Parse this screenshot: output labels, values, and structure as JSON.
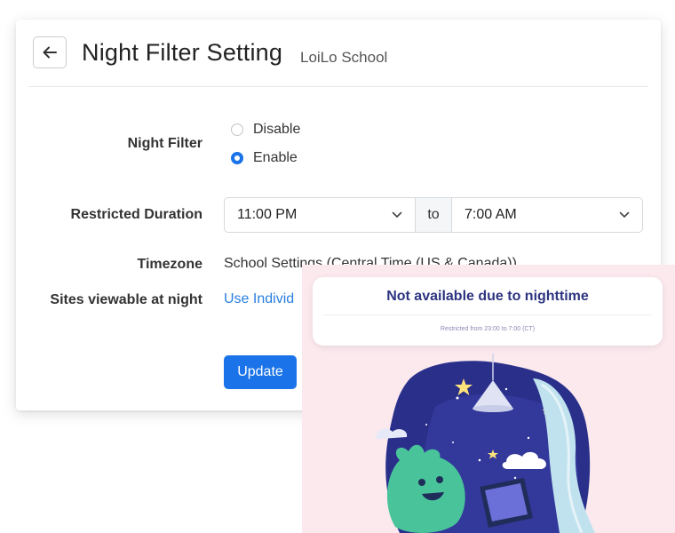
{
  "header": {
    "title": "Night Filter Setting",
    "subtitle": "LoiLo School"
  },
  "night_filter": {
    "label": "Night Filter",
    "options": [
      {
        "label": "Disable",
        "selected": false
      },
      {
        "label": "Enable",
        "selected": true
      }
    ]
  },
  "restricted_duration": {
    "label": "Restricted Duration",
    "start": "11:00 PM",
    "separator": "to",
    "end": "7:00 AM"
  },
  "timezone": {
    "label": "Timezone",
    "value": "School Settings (Central Time (US & Canada))"
  },
  "sites": {
    "label": "Sites viewable at night",
    "link": "Use Individ"
  },
  "actions": {
    "update_label": "Update"
  },
  "overlay": {
    "notice_title": "Not available due to nighttime",
    "notice_subtitle": "Restricted from 23:00 to 7:00 (CT)"
  },
  "colors": {
    "primary": "#1a73e8",
    "link": "#2b7fe0",
    "notice_title": "#2d3480",
    "overlay_bg": "#fbe9ee"
  },
  "icons": {
    "back": "arrow-left-icon",
    "dropdown": "chevron-down-icon"
  }
}
